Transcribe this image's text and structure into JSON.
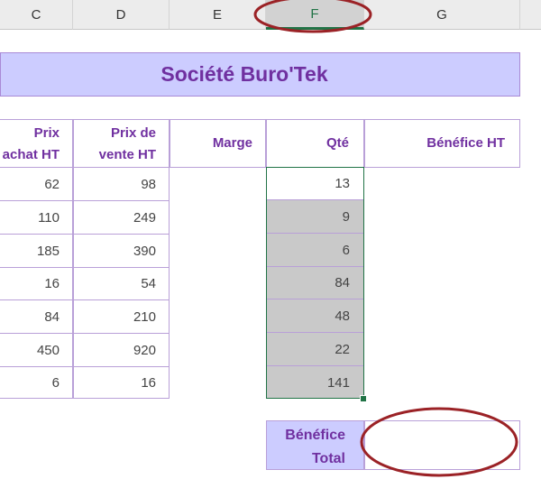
{
  "column_headers": [
    "C",
    "D",
    "E",
    "F",
    "G"
  ],
  "selected_column": "F",
  "title": "Société Buro'Tek",
  "headers": {
    "prix_achat_line1": "Prix",
    "prix_achat_line2": "achat HT",
    "prix_vente_line1": "Prix de",
    "prix_vente_line2": "vente HT",
    "marge": "Marge",
    "qte": "Qté",
    "benefice": "Bénéfice HT"
  },
  "rows": [
    {
      "achat": "62",
      "vente": "98",
      "qte": "13"
    },
    {
      "achat": "110",
      "vente": "249",
      "qte": "9"
    },
    {
      "achat": "185",
      "vente": "390",
      "qte": "6"
    },
    {
      "achat": "16",
      "vente": "54",
      "qte": "84"
    },
    {
      "achat": "84",
      "vente": "210",
      "qte": "48"
    },
    {
      "achat": "450",
      "vente": "920",
      "qte": "22"
    },
    {
      "achat": "6",
      "vente": "16",
      "qte": "141"
    }
  ],
  "total": {
    "label_line1": "Bénéfice",
    "label_line2": "Total",
    "value": ""
  },
  "colors": {
    "accent_purple": "#7030a0",
    "title_bg": "#ccccff",
    "selection_green": "#217346",
    "annotation_red": "#9b2226"
  }
}
